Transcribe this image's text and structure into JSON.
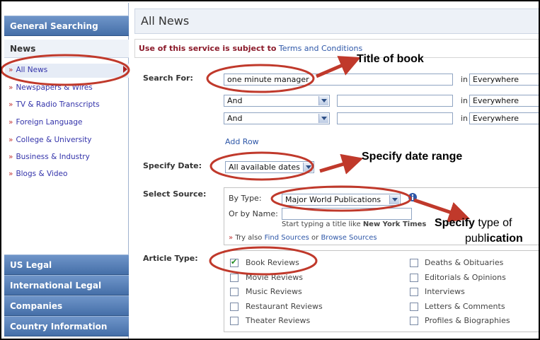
{
  "sidebar": {
    "general": "General Searching",
    "news": "News",
    "items": [
      {
        "label": "All News"
      },
      {
        "label": "Newspapers & Wires"
      },
      {
        "label": "TV & Radio Transcripts"
      },
      {
        "label": "Foreign Language"
      },
      {
        "label": "College & University"
      },
      {
        "label": "Business & Industry"
      },
      {
        "label": "Blogs & Video"
      }
    ],
    "bottom": [
      {
        "label": "US Legal"
      },
      {
        "label": "International Legal"
      },
      {
        "label": "Companies"
      },
      {
        "label": "Country Information"
      }
    ]
  },
  "main": {
    "title": "All News",
    "notice_prefix": "Use of this service is subject to",
    "notice_link": "Terms and Conditions",
    "search_for_label": "Search For:",
    "search_value": "one minute manager",
    "in_label": "in",
    "rows": [
      {
        "operator": "",
        "value": "one minute manager",
        "scope": "Everywhere"
      },
      {
        "operator": "And",
        "value": "",
        "scope": "Everywhere"
      },
      {
        "operator": "And",
        "value": "",
        "scope": "Everywhere"
      }
    ],
    "add_row": "Add Row",
    "specify_date_label": "Specify Date:",
    "date_value": "All available dates",
    "select_source_label": "Select Source:",
    "by_type_label": "By Type:",
    "by_type_value": "Major World Publications",
    "by_name_label": "Or by Name:",
    "hint_prefix": "Start typing a title like",
    "hint_example": "New York Times",
    "try_also": "Try also",
    "find_sources": "Find Sources",
    "or": "or",
    "browse_sources": "Browse Sources",
    "article_type_label": "Article Type:",
    "article_types_left": [
      {
        "label": "Book Reviews",
        "checked": true
      },
      {
        "label": "Movie Reviews",
        "checked": false
      },
      {
        "label": "Music Reviews",
        "checked": false
      },
      {
        "label": "Restaurant Reviews",
        "checked": false
      },
      {
        "label": "Theater Reviews",
        "checked": false
      }
    ],
    "article_types_right": [
      {
        "label": "Deaths & Obituaries",
        "checked": false
      },
      {
        "label": "Editorials & Opinions",
        "checked": false
      },
      {
        "label": "Interviews",
        "checked": false
      },
      {
        "label": "Letters & Comments",
        "checked": false
      },
      {
        "label": "Profiles & Biographies",
        "checked": false
      }
    ]
  },
  "annotations": {
    "title_of_book": "Title of book",
    "date_range": "Specify date range",
    "type_line1_bold": "Specify",
    "type_line1_rest": "type of",
    "type_line2_a": "publ",
    "type_line2_b": "ication",
    "color": "#c0392b"
  },
  "icons": {
    "info": "info-icon",
    "dropdown": "chevron-down-icon"
  }
}
